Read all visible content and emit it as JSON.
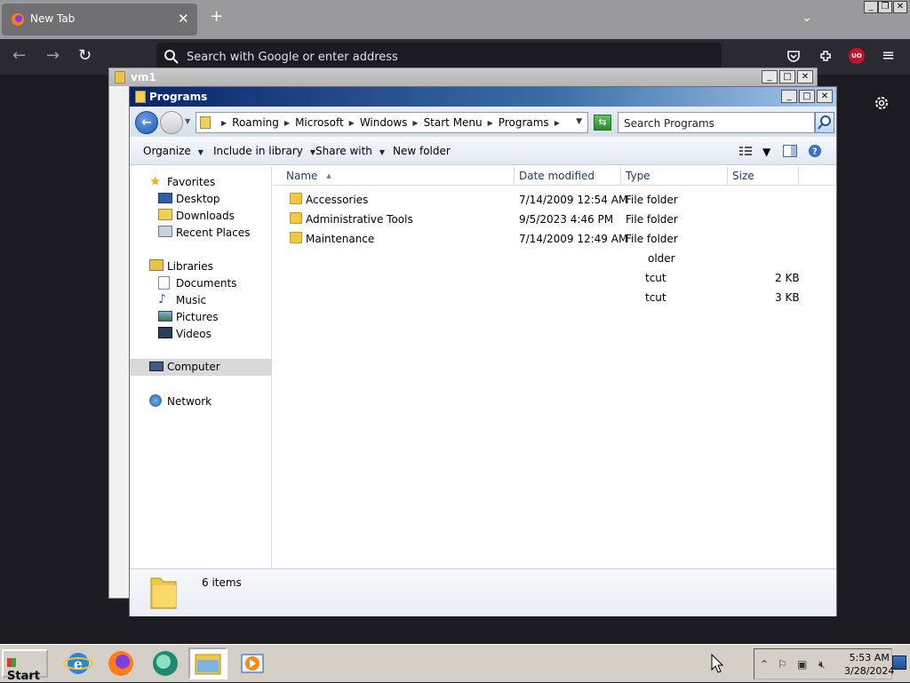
{
  "browser": {
    "tab_title": "New Tab",
    "tab_close": "✕",
    "new_tab": "+",
    "list_all_tabs": "⌄",
    "url_placeholder": "Search with Google or enter address",
    "back": "←",
    "forward": "→",
    "reload": "↻",
    "extension_badge": "UO",
    "menu": "≡"
  },
  "host_controls": [
    "_",
    "❐",
    "✕"
  ],
  "back_window": {
    "title": "vm1",
    "controls": [
      "_",
      "□",
      "✕"
    ]
  },
  "explorer": {
    "title": "Programs",
    "controls": [
      "_",
      "□",
      "✕"
    ],
    "breadcrumbs": [
      "Roaming",
      "Microsoft",
      "Windows",
      "Start Menu",
      "Programs"
    ],
    "search_placeholder": "Search Programs",
    "toolbar": {
      "organize": "Organize",
      "include_in_library": "Include in library",
      "share_with": "Share with",
      "new_folder": "New folder"
    },
    "nav": {
      "favorites": "Favorites",
      "desktop": "Desktop",
      "downloads": "Downloads",
      "recent_places": "Recent Places",
      "libraries": "Libraries",
      "documents": "Documents",
      "music": "Music",
      "pictures": "Pictures",
      "videos": "Videos",
      "computer": "Computer",
      "network": "Network"
    },
    "columns": {
      "name": "Name",
      "date_modified": "Date modified",
      "type": "Type",
      "size": "Size"
    },
    "rows": [
      {
        "name": "Accessories",
        "date": "7/14/2009 12:54 AM",
        "type": "File folder",
        "size": ""
      },
      {
        "name": "Administrative Tools",
        "date": "9/5/2023 4:46 PM",
        "type": "File folder",
        "size": ""
      },
      {
        "name": "Maintenance",
        "date": "7/14/2009 12:49 AM",
        "type": "File folder",
        "size": ""
      }
    ],
    "ghost_rows": [
      {
        "type": "older",
        "size": ""
      },
      {
        "type": "tcut",
        "size": "2 KB"
      },
      {
        "type": "tcut",
        "size": "3 KB"
      }
    ],
    "status": "6 items"
  },
  "taskbar": {
    "start_label": "Start",
    "time": "5:53 AM",
    "date": "3/28/2024"
  }
}
